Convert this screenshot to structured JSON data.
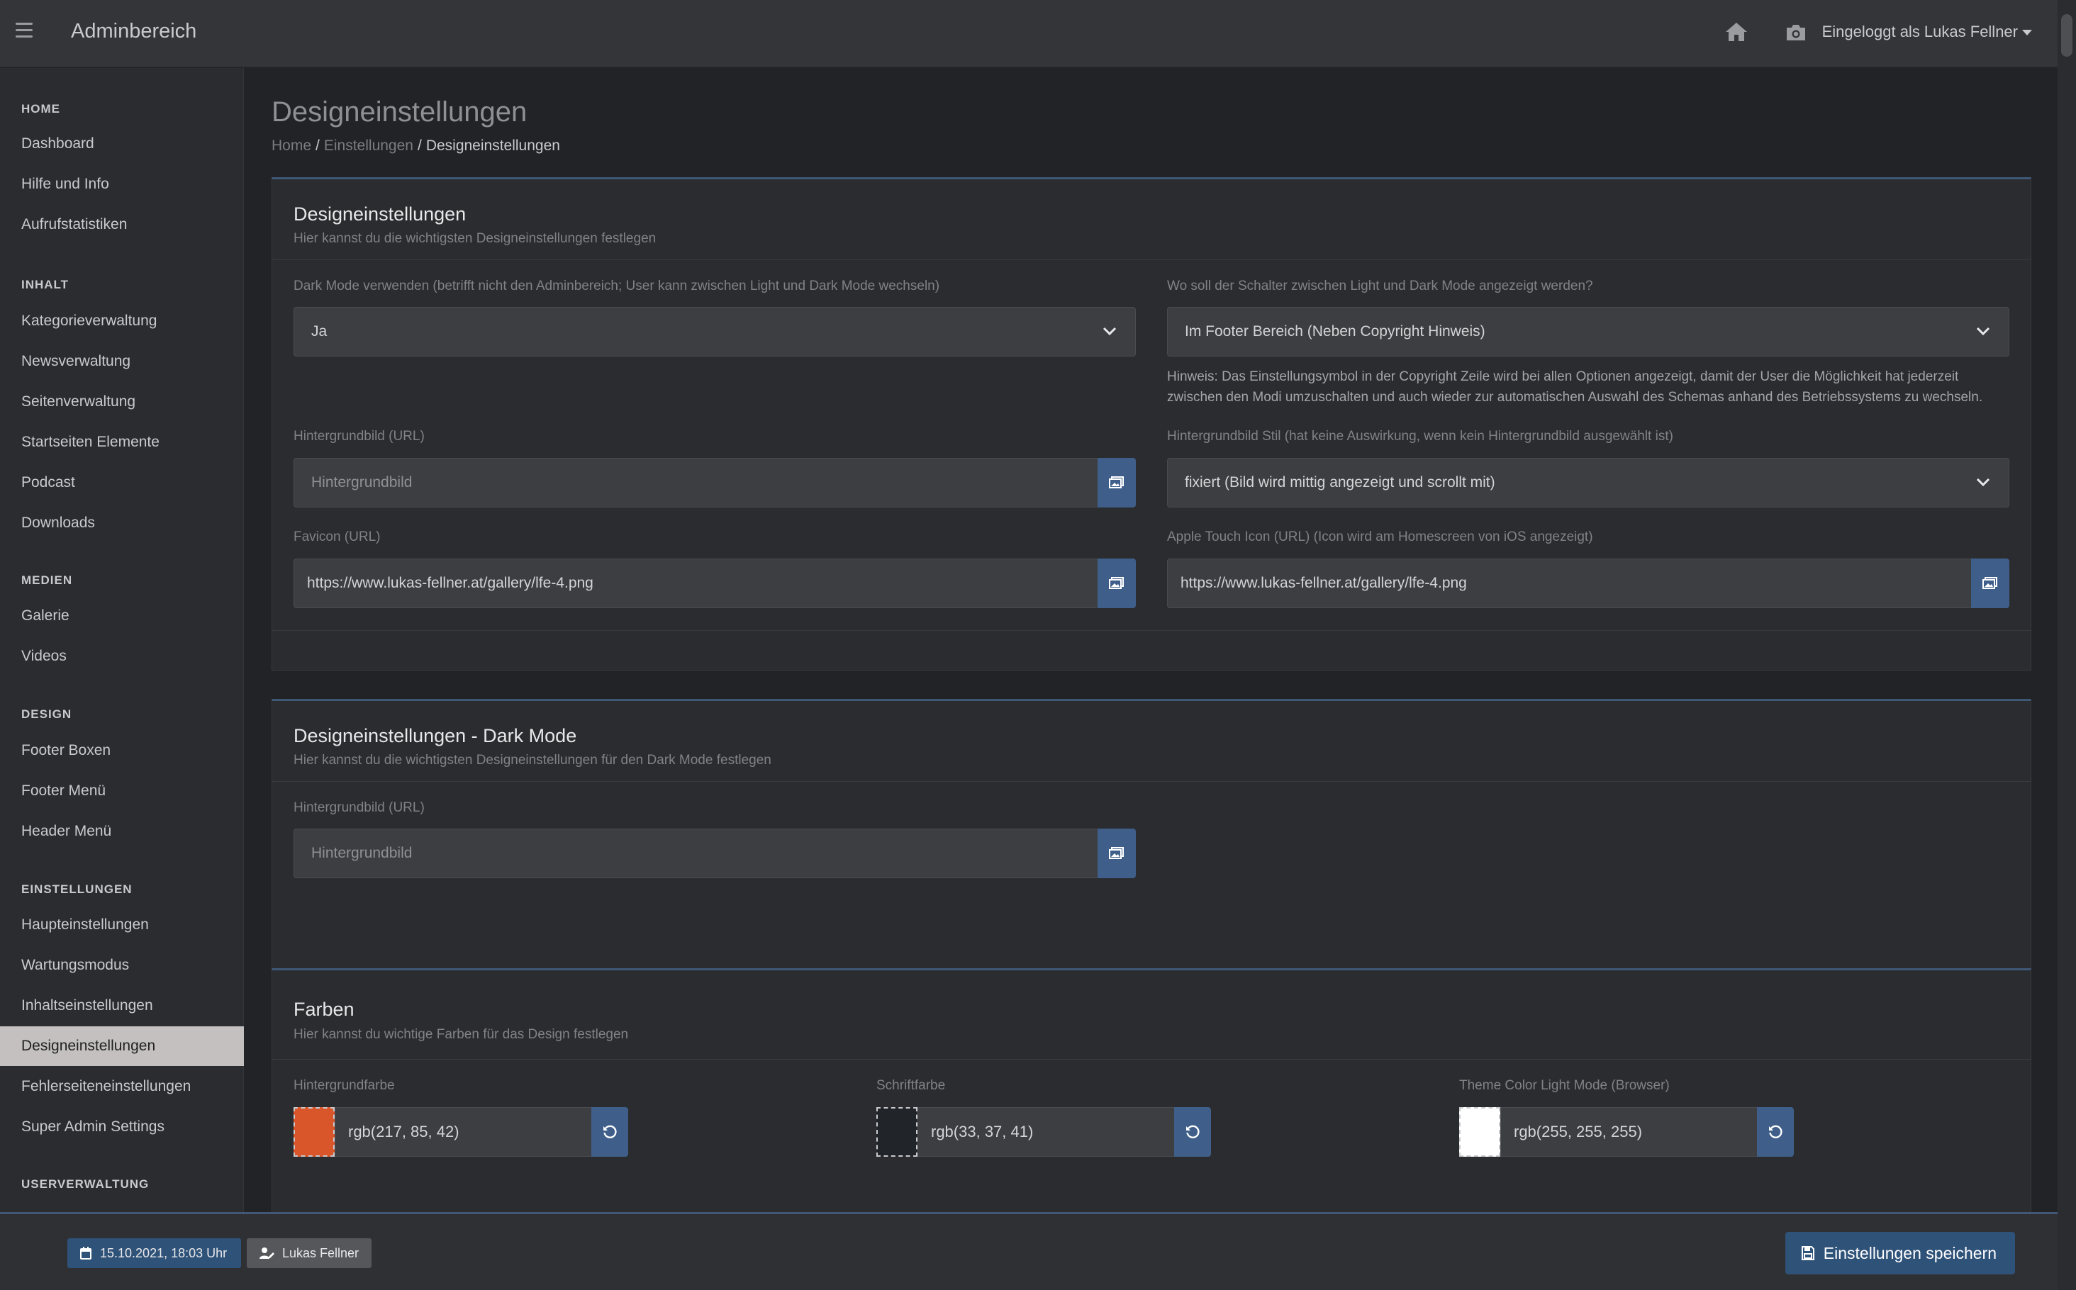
{
  "topbar": {
    "app_title": "Adminbereich",
    "user_menu": "Eingeloggt als Lukas Fellner"
  },
  "sidebar": {
    "sections": [
      {
        "heading": "HOME",
        "items": [
          "Dashboard",
          "Hilfe und Info",
          "Aufrufstatistiken"
        ]
      },
      {
        "heading": "INHALT",
        "items": [
          "Kategorieverwaltung",
          "Newsverwaltung",
          "Seitenverwaltung",
          "Startseiten Elemente",
          "Podcast",
          "Downloads"
        ]
      },
      {
        "heading": "MEDIEN",
        "items": [
          "Galerie",
          "Videos"
        ]
      },
      {
        "heading": "DESIGN",
        "items": [
          "Footer Boxen",
          "Footer Menü",
          "Header Menü"
        ]
      },
      {
        "heading": "EINSTELLUNGEN",
        "items": [
          "Haupteinstellungen",
          "Wartungsmodus",
          "Inhaltseinstellungen",
          "Designeinstellungen",
          "Fehlerseiteneinstellungen",
          "Super Admin Settings"
        ]
      },
      {
        "heading": "USERVERWALTUNG",
        "items": []
      }
    ],
    "active_item": "Designeinstellungen"
  },
  "page": {
    "title": "Designeinstellungen",
    "breadcrumb": [
      "Home",
      "Einstellungen",
      "Designeinstellungen"
    ]
  },
  "design_card": {
    "title": "Designeinstellungen",
    "subtitle": "Hier kannst du die wichtigsten Designeinstellungen festlegen",
    "dark_mode_label": "Dark Mode verwenden (betrifft nicht den Adminbereich; User kann zwischen Light und Dark Mode wechseln)",
    "dark_mode_value": "Ja",
    "switch_label": "Wo soll der Schalter zwischen Light und Dark Mode angezeigt werden?",
    "switch_value": "Im Footer Bereich (Neben Copyright Hinweis)",
    "hint_line1": "Hinweis: Das Einstellungsymbol in der Copyright Zeile wird bei allen Optionen angezeigt, damit der User die Möglichkeit hat jederzeit",
    "hint_line2": "zwischen den Modi umzuschalten und auch wieder zur automatischen Auswahl des Schemas anhand des Betriebssystems zu wechseln.",
    "bg_label": "Hintergrundbild (URL)",
    "bg_placeholder": "Hintergrundbild",
    "bg_style_label": "Hintergrundbild Stil (hat keine Auswirkung, wenn kein Hintergrundbild ausgewählt ist)",
    "bg_style_value": "fixiert (Bild wird mittig angezeigt und scrollt mit)",
    "favicon_label": "Favicon (URL)",
    "favicon_value": "https://www.lukas-fellner.at/gallery/lfe-4.png",
    "apple_label": "Apple Touch Icon (URL) (Icon wird am Homescreen von iOS angezeigt)",
    "apple_value": "https://www.lukas-fellner.at/gallery/lfe-4.png"
  },
  "dark_card": {
    "title": "Designeinstellungen - Dark Mode",
    "subtitle": "Hier kannst du die wichtigsten Designeinstellungen für den Dark Mode festlegen",
    "bg_label": "Hintergrundbild (URL)",
    "bg_placeholder": "Hintergrundbild"
  },
  "colors_card": {
    "title": "Farben",
    "subtitle": "Hier kannst du wichtige Farben für das Design festlegen",
    "fields": [
      {
        "label": "Hintergrundfarbe",
        "value": "rgb(217, 85, 42)",
        "swatch": "#d9552a"
      },
      {
        "label": "Schriftfarbe",
        "value": "rgb(33, 37, 41)",
        "swatch": "#212529"
      },
      {
        "label": "Theme Color Light Mode (Browser)",
        "value": "rgb(255, 255, 255)",
        "swatch": "#ffffff"
      }
    ]
  },
  "bottombar": {
    "date_badge": "15.10.2021, 18:03 Uhr",
    "user_badge": "Lukas Fellner",
    "save_label": "Einstellungen speichern"
  },
  "icons": [
    "menu-icon",
    "home-icon",
    "camera-icon",
    "chevron-down-icon",
    "image-icon",
    "reset-icon",
    "calendar-icon",
    "user-edit-icon",
    "save-icon"
  ],
  "colors": {
    "accent": "#3f5f8a",
    "active_item_bg": "#c3c0bf",
    "page_bg": "#222326"
  }
}
